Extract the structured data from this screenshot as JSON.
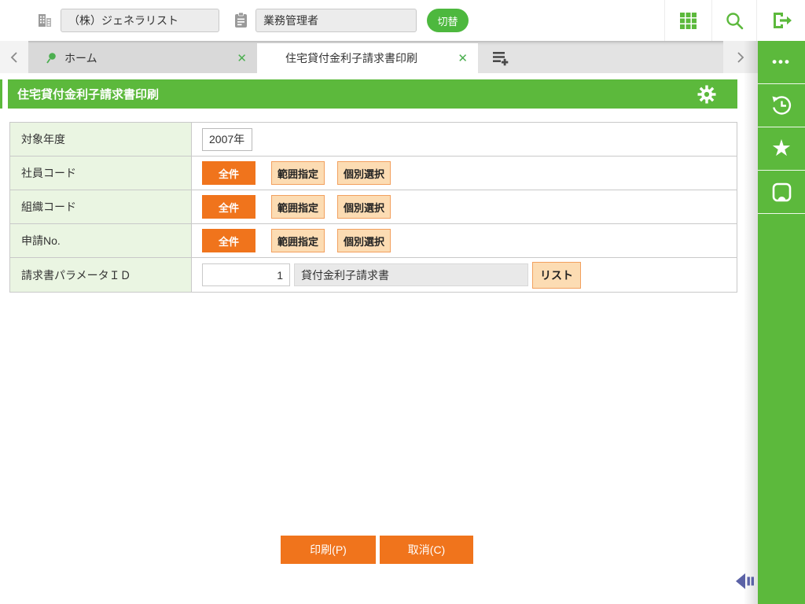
{
  "colors": {
    "brand_green": "#5cb93c",
    "accent_orange": "#f0741c",
    "peach": "#fcdcb3",
    "peach_border": "#f2a05e",
    "label_row_bg": "#eaf5e2",
    "collapse_arrow_blue": "#5b62a6"
  },
  "topbar": {
    "company": {
      "value": "（株）ジェネラリスト"
    },
    "role": {
      "value": "業務管理者"
    },
    "switch_button": "切替"
  },
  "tabbar": {
    "tabs": [
      {
        "label": "ホーム",
        "active": false,
        "pinned": true
      },
      {
        "label": "住宅貸付金利子請求書印刷",
        "active": true
      }
    ]
  },
  "icons": {
    "close_glyph": "✕",
    "more_glyph": "•••",
    "star_glyph": "★"
  },
  "page": {
    "title": "住宅貸付金利子請求書印刷"
  },
  "form": {
    "rows": [
      {
        "label": "対象年度",
        "type": "text-input",
        "value": "2007年"
      },
      {
        "label": "社員コード",
        "type": "segmented",
        "selected": "全件",
        "buttons": [
          "全件",
          "範囲指定",
          "個別選択"
        ]
      },
      {
        "label": "組織コード",
        "type": "segmented",
        "selected": "全件",
        "buttons": [
          "全件",
          "範囲指定",
          "個別選択"
        ]
      },
      {
        "label": "申請No.",
        "type": "segmented",
        "selected": "全件",
        "buttons": [
          "全件",
          "範囲指定",
          "個別選択"
        ]
      },
      {
        "label": "請求書パラメータＩＤ",
        "type": "id-lookup",
        "id_value": "1",
        "name_value": "貸付金利子請求書",
        "list_button": "リスト"
      }
    ]
  },
  "footer_actions": {
    "print": "印刷(P)",
    "cancel": "取消(C)"
  }
}
